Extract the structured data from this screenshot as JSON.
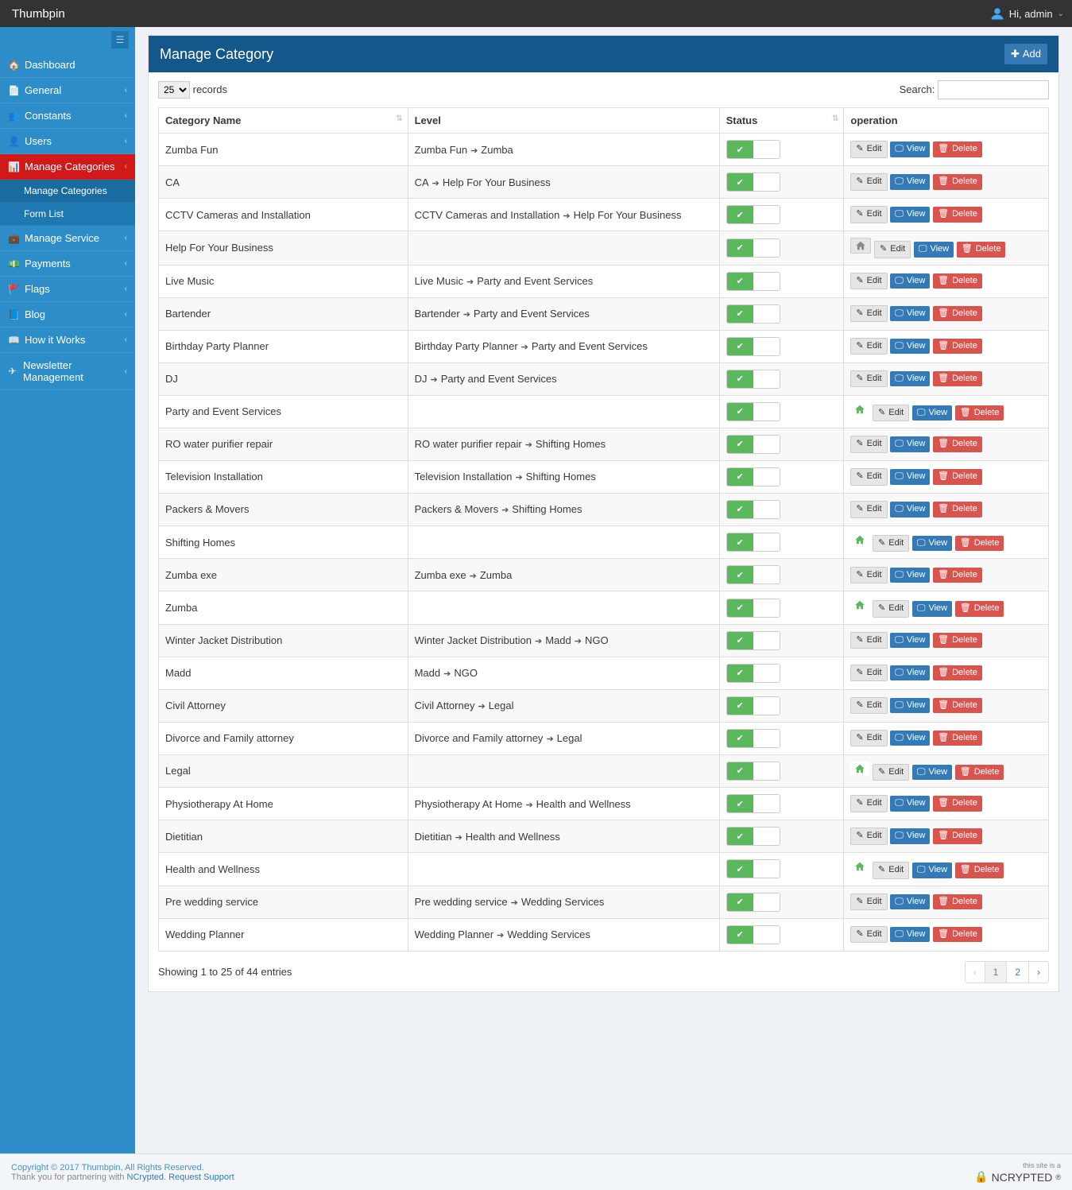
{
  "brand": "Thumbpin",
  "user": {
    "greeting": "Hi, admin"
  },
  "sidebar": {
    "items": [
      {
        "icon": "🏠",
        "label": "Dashboard",
        "caret": false
      },
      {
        "icon": "📄",
        "label": "General",
        "caret": true
      },
      {
        "icon": "👥",
        "label": "Constants",
        "caret": true
      },
      {
        "icon": "👤",
        "label": "Users",
        "caret": true
      },
      {
        "icon": "📊",
        "label": "Manage Categories",
        "caret": true,
        "active": true,
        "sub": [
          {
            "label": "Manage Categories",
            "selected": true
          },
          {
            "label": "Form List"
          }
        ]
      },
      {
        "icon": "💼",
        "label": "Manage Service",
        "caret": true
      },
      {
        "icon": "💵",
        "label": "Payments",
        "caret": true
      },
      {
        "icon": "🚩",
        "label": "Flags",
        "caret": true
      },
      {
        "icon": "📘",
        "label": "Blog",
        "caret": true
      },
      {
        "icon": "📖",
        "label": "How it Works",
        "caret": true
      },
      {
        "icon": "✈",
        "label": "Newsletter Management",
        "caret": true
      }
    ]
  },
  "page": {
    "title": "Manage Category",
    "add_label": "Add",
    "records_label": "records",
    "records_value": "25",
    "search_label": "Search:",
    "columns": {
      "name": "Category Name",
      "level": "Level",
      "status": "Status",
      "op": "operation"
    },
    "buttons": {
      "edit": "Edit",
      "view": "View",
      "delete": "Delete"
    },
    "info": "Showing 1 to 25 of 44 entries",
    "pages": [
      "1",
      "2"
    ]
  },
  "rows": [
    {
      "name": "Zumba Fun",
      "level": [
        "Zumba Fun",
        "Zumba"
      ]
    },
    {
      "name": "CA",
      "level": [
        "CA",
        "Help For Your Business"
      ]
    },
    {
      "name": "CCTV Cameras and Installation",
      "level": [
        "CCTV Cameras and Installation",
        "Help For Your Business"
      ]
    },
    {
      "name": "Help For Your Business",
      "level": [],
      "root": true
    },
    {
      "name": "Live Music",
      "level": [
        "Live Music",
        "Party and Event Services"
      ]
    },
    {
      "name": "Bartender",
      "level": [
        "Bartender",
        "Party and Event Services"
      ]
    },
    {
      "name": "Birthday Party Planner",
      "level": [
        "Birthday Party Planner",
        "Party and Event Services"
      ]
    },
    {
      "name": "DJ",
      "level": [
        "DJ",
        "Party and Event Services"
      ]
    },
    {
      "name": "Party and Event Services",
      "level": [],
      "root": true,
      "green": true
    },
    {
      "name": "RO water purifier repair",
      "level": [
        "RO water purifier repair",
        "Shifting Homes"
      ]
    },
    {
      "name": "Television Installation",
      "level": [
        "Television Installation",
        "Shifting Homes"
      ]
    },
    {
      "name": "Packers & Movers",
      "level": [
        "Packers & Movers",
        "Shifting Homes"
      ]
    },
    {
      "name": "Shifting Homes",
      "level": [],
      "root": true,
      "green": true
    },
    {
      "name": "Zumba exe",
      "level": [
        "Zumba exe",
        "Zumba"
      ]
    },
    {
      "name": "Zumba",
      "level": [],
      "root": true,
      "green": true
    },
    {
      "name": "Winter Jacket Distribution",
      "level": [
        "Winter Jacket Distribution",
        "Madd",
        "NGO"
      ]
    },
    {
      "name": "Madd",
      "level": [
        "Madd",
        "NGO"
      ]
    },
    {
      "name": "Civil Attorney",
      "level": [
        "Civil Attorney",
        "Legal"
      ]
    },
    {
      "name": "Divorce and Family attorney",
      "level": [
        "Divorce and Family attorney",
        "Legal"
      ]
    },
    {
      "name": "Legal",
      "level": [],
      "root": true,
      "green": true
    },
    {
      "name": "Physiotherapy At Home",
      "level": [
        "Physiotherapy At Home",
        "Health and Wellness"
      ]
    },
    {
      "name": "Dietitian",
      "level": [
        "Dietitian",
        "Health and Wellness"
      ]
    },
    {
      "name": "Health and Wellness",
      "level": [],
      "root": true,
      "green": true
    },
    {
      "name": "Pre wedding service",
      "level": [
        "Pre wedding service",
        "Wedding Services"
      ]
    },
    {
      "name": "Wedding Planner",
      "level": [
        "Wedding Planner",
        "Wedding Services"
      ]
    }
  ],
  "footer": {
    "copyright": "Copyright © 2017 Thumbpin, All Rights Reserved.",
    "thanks_prefix": "Thank you for partnering with ",
    "ncrypted": "NCrypted",
    "thanks_mid": ". ",
    "support": "Request Support",
    "badge_small": "this site is a",
    "badge": "NCRYPTED"
  }
}
